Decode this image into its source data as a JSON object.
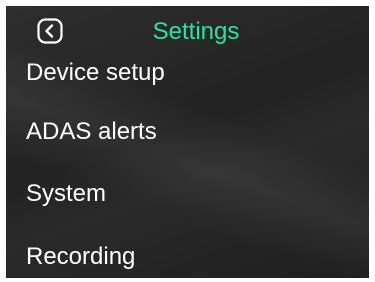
{
  "header": {
    "title": "Settings",
    "back_icon": "chevron-left-icon",
    "accent_color": "#2fe0a0"
  },
  "menu": {
    "items": [
      {
        "label": "Device setup"
      },
      {
        "label": "ADAS alerts"
      },
      {
        "label": "System"
      },
      {
        "label": "Recording"
      }
    ]
  }
}
